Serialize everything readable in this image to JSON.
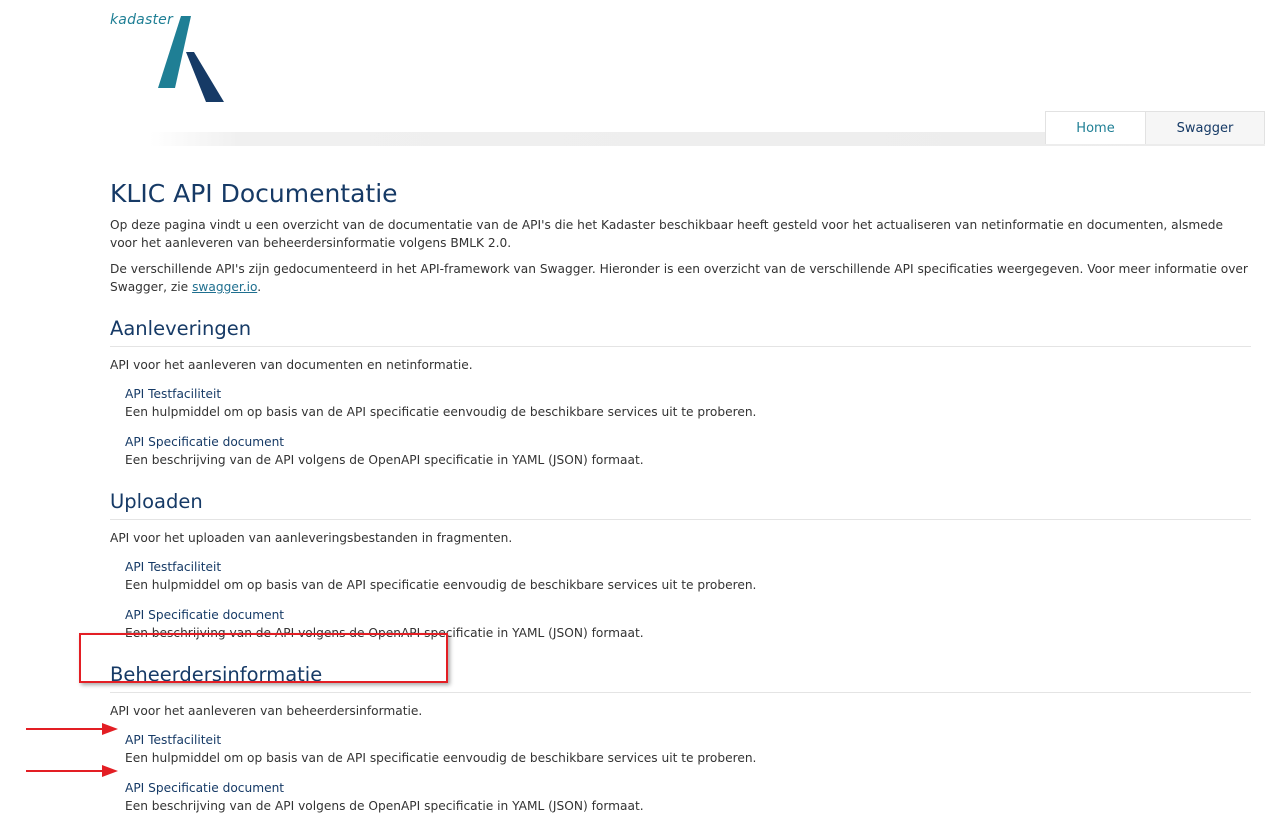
{
  "logo": {
    "text": "kadaster"
  },
  "nav": {
    "tabs": [
      {
        "label": "Home"
      },
      {
        "label": "Swagger"
      }
    ]
  },
  "page": {
    "title": "KLIC API Documentatie",
    "intro1": "Op deze pagina vindt u een overzicht van de documentatie van de API's die het Kadaster beschikbaar heeft gesteld voor het actualiseren van netinformatie en documenten, alsmede voor het aanleveren van beheerdersinformatie volgens BMLK 2.0.",
    "intro2_before": "De verschillende API's zijn gedocumenteerd in het API-framework van Swagger. Hieronder is een overzicht van de verschillende API specificaties weergegeven. Voor meer informatie over Swagger, zie ",
    "intro2_link": "swagger.io",
    "intro2_after": "."
  },
  "sections": [
    {
      "title": "Aanleveringen",
      "description": "API voor het aanleveren van documenten en netinformatie.",
      "items": [
        {
          "link": "API Testfaciliteit",
          "desc": "Een hulpmiddel om op basis van de API specificatie eenvoudig de beschikbare services uit te proberen."
        },
        {
          "link": "API Specificatie document",
          "desc": "Een beschrijving van de API volgens de OpenAPI specificatie in YAML (JSON) formaat."
        }
      ]
    },
    {
      "title": "Uploaden",
      "description": "API voor het uploaden van aanleveringsbestanden in fragmenten.",
      "items": [
        {
          "link": "API Testfaciliteit",
          "desc": "Een hulpmiddel om op basis van de API specificatie eenvoudig de beschikbare services uit te proberen."
        },
        {
          "link": "API Specificatie document",
          "desc": "Een beschrijving van de API volgens de OpenAPI specificatie in YAML (JSON) formaat."
        }
      ]
    },
    {
      "title": "Beheerdersinformatie",
      "description": "API voor het aanleveren van beheerdersinformatie.",
      "items": [
        {
          "link": "API Testfaciliteit",
          "desc": "Een hulpmiddel om op basis van de API specificatie eenvoudig de beschikbare services uit te proberen."
        },
        {
          "link": "API Specificatie document",
          "desc": "Een beschrijving van de API volgens de OpenAPI specificatie in YAML (JSON) formaat."
        }
      ]
    }
  ],
  "colors": {
    "heading": "#163a66",
    "logo_teal": "#1f7f95",
    "logo_navy": "#163a66",
    "annotation_red": "#e31e24"
  }
}
